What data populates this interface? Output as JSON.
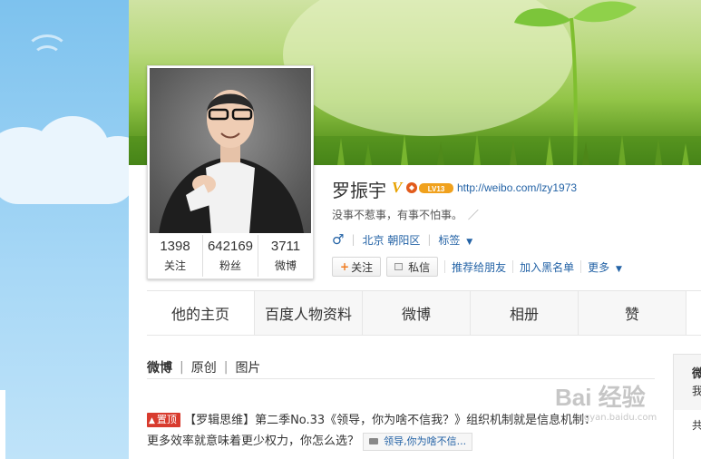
{
  "profile": {
    "name": "罗振宇",
    "v_badge": "V",
    "level_badge": "LV13",
    "url": "http://weibo.com/lzy1973",
    "motto": "没事不惹事，有事不怕事。",
    "gender_symbol": "♂",
    "location": "北京 朝阳区",
    "tags_label": "标签",
    "stats": [
      {
        "value": "1398",
        "label": "关注"
      },
      {
        "value": "642169",
        "label": "粉丝"
      },
      {
        "value": "3711",
        "label": "微博"
      }
    ]
  },
  "actions": {
    "follow": "关注",
    "message": "私信",
    "recommend": "推荐给朋友",
    "blacklist": "加入黑名单",
    "more": "更多"
  },
  "tabs": [
    "他的主页",
    "百度人物资料",
    "微博",
    "相册",
    "赞"
  ],
  "subtabs": [
    "微博",
    "原创",
    "图片"
  ],
  "post": {
    "pin_label": "置顶",
    "line1": "【罗辑思维】第二季No.33《领导，你为啥不信我？》组织机制就是信息机制：",
    "line2": "更多效率就意味着更少权力，你怎么选？",
    "video_label": "领导,你为啥不信..."
  },
  "sidebar": {
    "text1": "微",
    "text2": "我",
    "text3": "共"
  },
  "watermark": {
    "brand": "Bai 经验",
    "site": "jingyan.baidu.com"
  },
  "colors": {
    "link": "#2463a6",
    "pin": "#d83b2e",
    "badge": "#e8a200"
  }
}
